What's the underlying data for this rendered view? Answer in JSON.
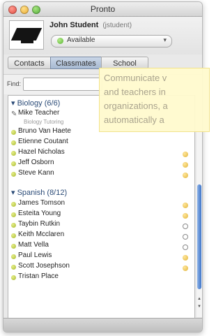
{
  "window": {
    "title": "Pronto"
  },
  "user": {
    "name": "John Student",
    "handle": "(jstudent)",
    "status": "Available"
  },
  "tabs": [
    "Contacts",
    "Classmates",
    "School"
  ],
  "find": {
    "label": "Find:",
    "value": ""
  },
  "tooltip": {
    "lines": [
      "Communicate v",
      "and teachers in",
      "organizations, a",
      "automatically a"
    ]
  },
  "groups": [
    {
      "header": "Biology (6/6)",
      "items": [
        {
          "name": "Mike Teacher",
          "sub": "Biology Tutoring"
        },
        {
          "name": "Bruno Van Haete"
        },
        {
          "name": "Etienne Coutant"
        },
        {
          "name": "Hazel Nicholas"
        },
        {
          "name": "Jeff Osborn"
        },
        {
          "name": "Steve Kann"
        }
      ]
    },
    {
      "header": "Spanish (8/12)",
      "items": [
        {
          "name": "James Tomson"
        },
        {
          "name": "Esteita Young"
        },
        {
          "name": "Taybin Rutkin"
        },
        {
          "name": "Keith Mcclaren"
        },
        {
          "name": "Matt Vella"
        },
        {
          "name": "Paul Lewis"
        },
        {
          "name": "Scott Josephson"
        },
        {
          "name": "Tristan Place"
        }
      ]
    }
  ]
}
